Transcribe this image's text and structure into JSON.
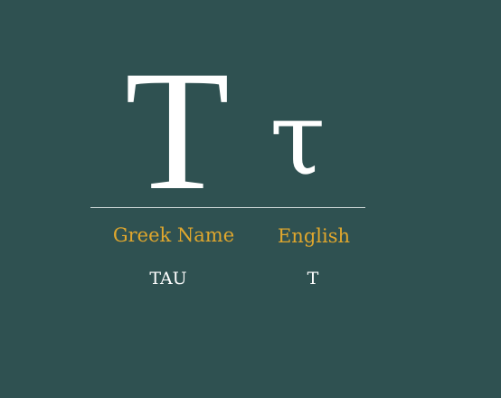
{
  "letter": {
    "uppercase": "Τ",
    "lowercase": "τ"
  },
  "table": {
    "headers": {
      "greek_name": "Greek Name",
      "english": "English"
    },
    "values": {
      "greek_name": "TAU",
      "english": "T"
    }
  },
  "colors": {
    "background": "#2f5151",
    "heading": "#e0a72d",
    "text": "#ffffff"
  }
}
